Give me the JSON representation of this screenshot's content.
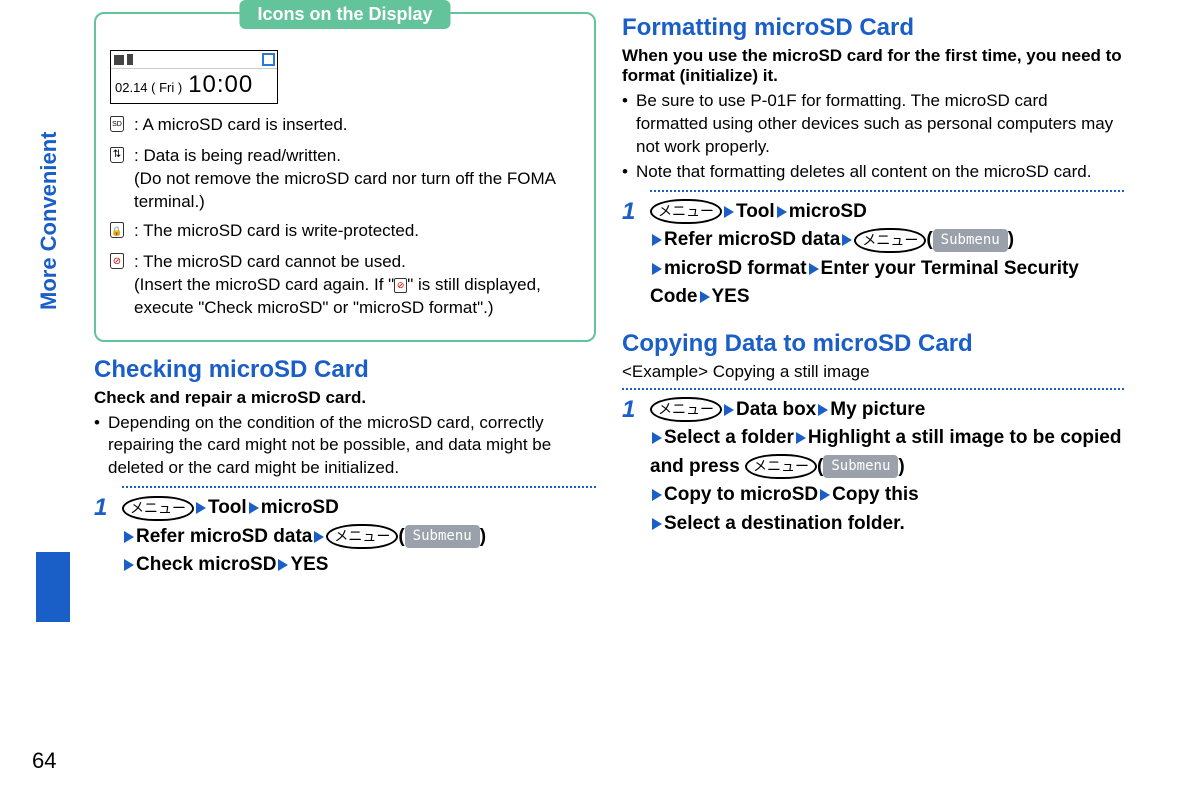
{
  "page_number": "64",
  "sidebar_label": "More Convenient",
  "icons_box": {
    "title": "Icons on the Display",
    "display_date": "02.14 ( Fri )",
    "display_time": "10:00",
    "rows": [
      {
        "text1": ": A microSD card is inserted."
      },
      {
        "text1": ": Data is being read/written.",
        "text2": "(Do not remove the microSD card nor turn off the FOMA terminal.)"
      },
      {
        "text1": ": The microSD card is write-protected."
      },
      {
        "text1": ": The microSD card cannot be used.",
        "text2a": "(Insert the microSD card again. If \"",
        "text2b": "\" is still displayed, execute \"Check microSD\" or \"microSD format\".)"
      }
    ]
  },
  "checking": {
    "heading": "Checking microSD Card",
    "lead": "Check and repair a microSD card.",
    "bullet": "Depending on the condition of the microSD card, correctly repairing the card might not be possible, and data might be deleted or the card might be initialized.",
    "step": {
      "num": "1",
      "menu_label": "メニュー",
      "tool": "Tool",
      "microsd": "microSD",
      "refer": "Refer microSD data",
      "submenu": "Submenu",
      "check": "Check microSD",
      "yes": "YES"
    }
  },
  "formatting": {
    "heading": "Formatting microSD Card",
    "lead": "When you use the microSD card for the first time, you need to format (initialize) it.",
    "bullet1": "Be sure to use P-01F for formatting. The microSD card formatted using other devices such as personal computers may not work properly.",
    "bullet2": "Note that formatting deletes all content on the microSD card.",
    "step": {
      "num": "1",
      "menu_label": "メニュー",
      "tool": "Tool",
      "microsd": "microSD",
      "refer": "Refer microSD data",
      "submenu": "Submenu",
      "format": "microSD format",
      "enter": "Enter your Terminal Security Code",
      "yes": "YES"
    }
  },
  "copying": {
    "heading": "Copying Data to microSD Card",
    "example": "<Example> Copying a still image",
    "step": {
      "num": "1",
      "menu_label": "メニュー",
      "databox": "Data box",
      "mypic": "My picture",
      "selfolder": "Select a folder",
      "highlight": "Highlight a still image to be copied and press ",
      "submenu": "Submenu",
      "copyto": "Copy to microSD",
      "copythis": "Copy this",
      "seldest": "Select a destination folder."
    }
  }
}
